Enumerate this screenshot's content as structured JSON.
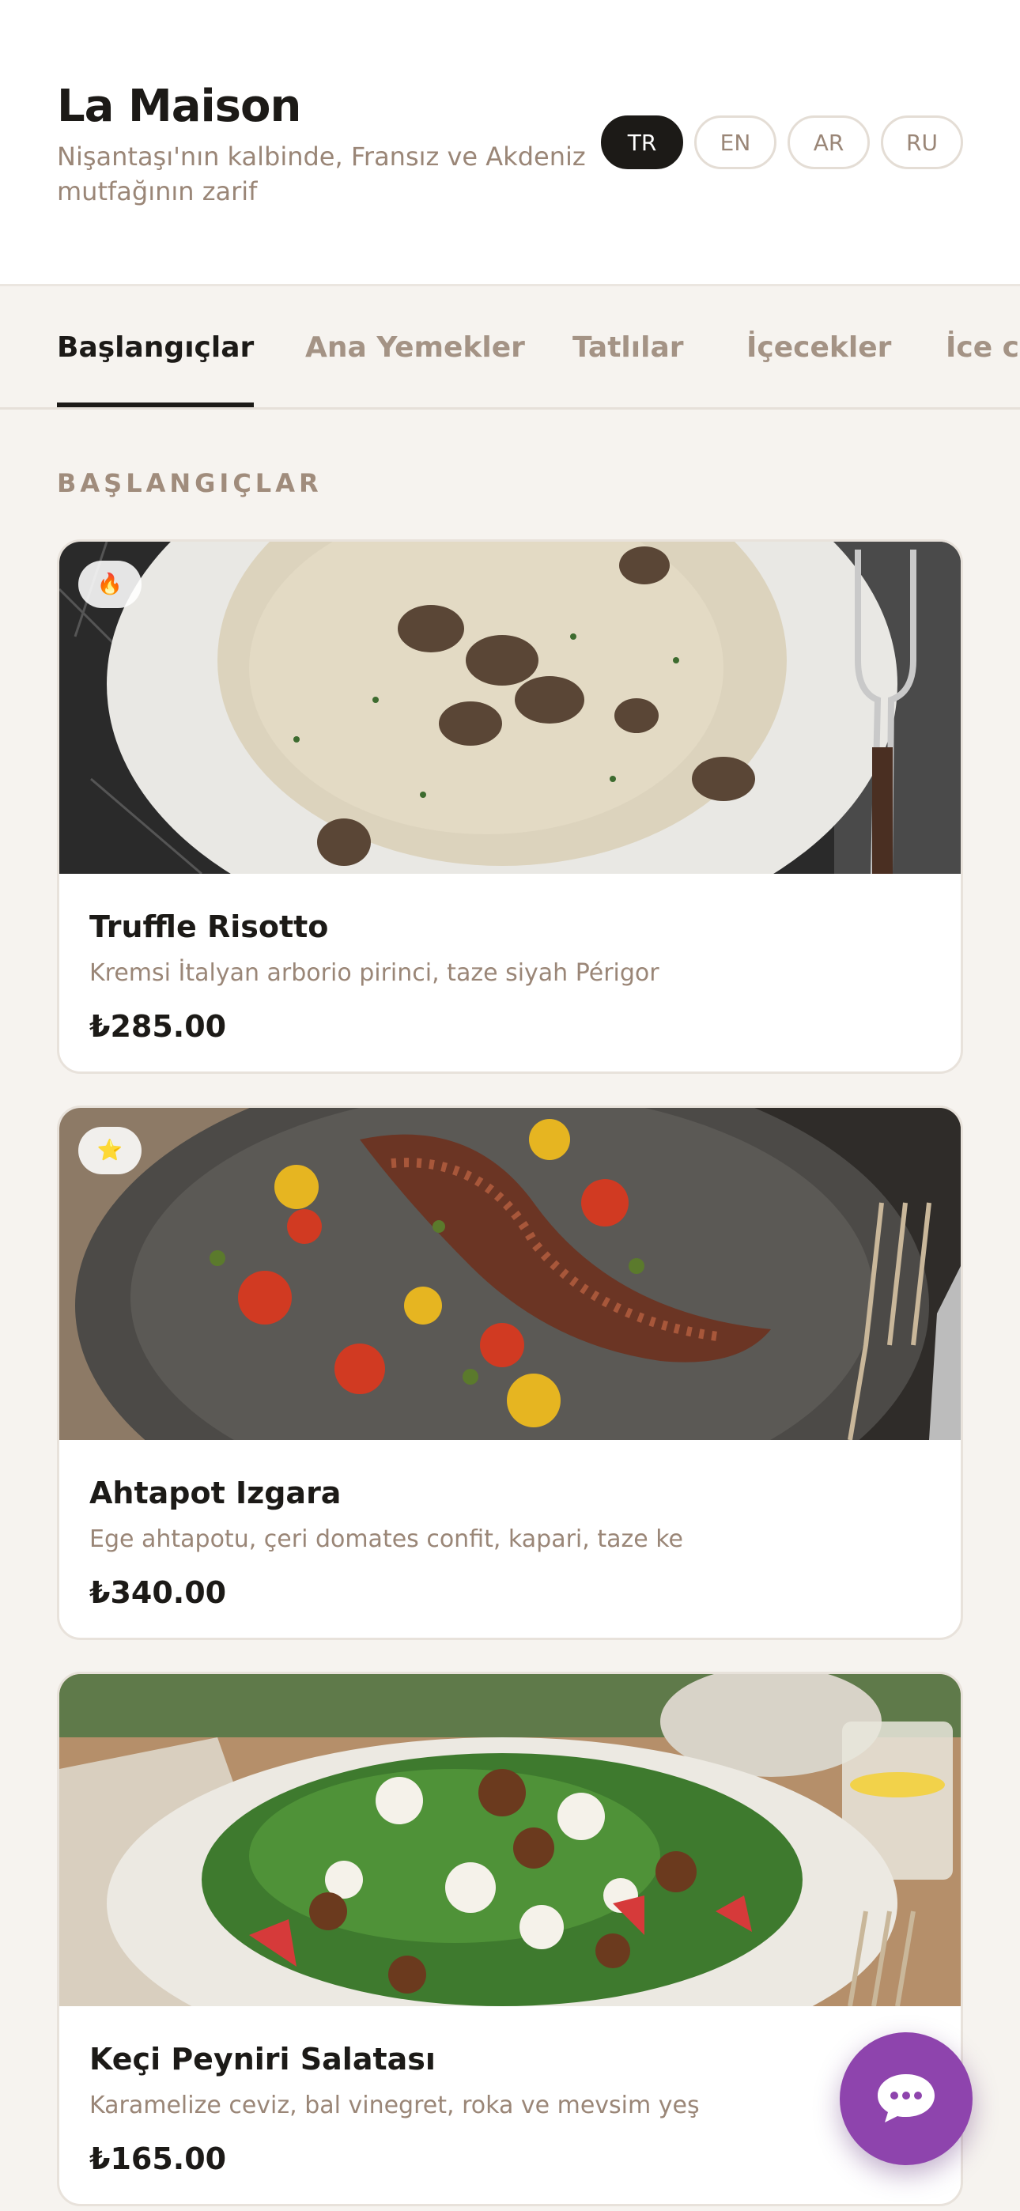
{
  "header": {
    "title": "La Maison",
    "subtitle": "Nişantaşı'nın kalbinde, Fransız ve Akdeniz mutfağının zarif",
    "languages": [
      "TR",
      "EN",
      "AR",
      "RU"
    ],
    "active_language": "TR"
  },
  "tabs": [
    "Başlangıçlar",
    "Ana Yemekler",
    "Tatlılar",
    "İçecekler",
    "İce co"
  ],
  "active_tab": "Başlangıçlar",
  "section": {
    "label": "BAŞLANGIÇLAR"
  },
  "items": [
    {
      "name": "Truffle Risotto",
      "description": "Kremsi İtalyan arborio pirinci, taze siyah Périgor",
      "price": "₺285.00",
      "badge": "🔥",
      "badge_icon": "fire-icon"
    },
    {
      "name": "Ahtapot Izgara",
      "description": "Ege ahtapotu, çeri domates confit, kapari, taze ke",
      "price": "₺340.00",
      "badge": "⭐",
      "badge_icon": "star-icon"
    },
    {
      "name": "Keçi Peyniri Salatası",
      "description": "Karamelize ceviz, bal vinegret, roka ve mevsim yeş",
      "price": "₺165.00",
      "badge": "",
      "badge_icon": ""
    }
  ],
  "colors": {
    "accent": "#8e44ad",
    "text": "#1c1a17",
    "muted": "#9a8677",
    "background": "#f6f3ef"
  },
  "chat": {
    "icon": "chat-bubble-icon"
  }
}
